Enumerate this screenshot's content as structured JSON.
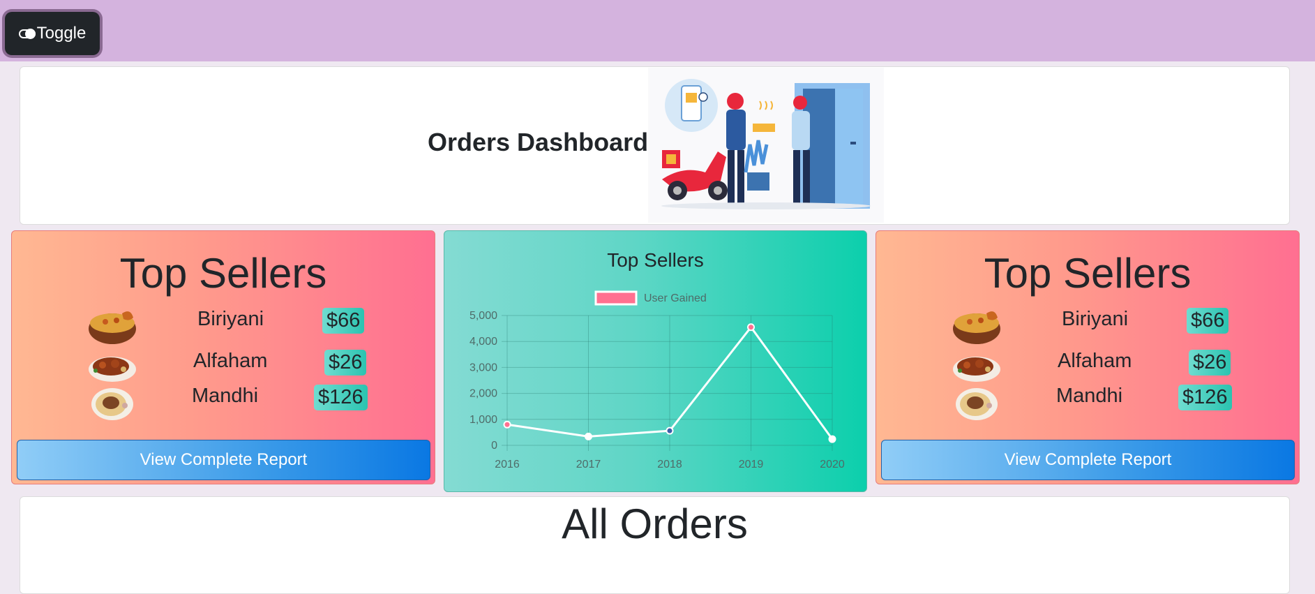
{
  "toolbar": {
    "toggle_label": "Toggle"
  },
  "header": {
    "title": "Orders Dashboard"
  },
  "top_sellers_left": {
    "title": "Top Sellers",
    "items": [
      {
        "name": "Biriyani",
        "price": "$66"
      },
      {
        "name": "Alfaham",
        "price": "$26"
      },
      {
        "name": "Mandhi",
        "price": "$126"
      }
    ],
    "button_label": "View Complete Report"
  },
  "top_sellers_right": {
    "title": "Top Sellers",
    "items": [
      {
        "name": "Biriyani",
        "price": "$66"
      },
      {
        "name": "Alfaham",
        "price": "$26"
      },
      {
        "name": "Mandhi",
        "price": "$126"
      }
    ],
    "button_label": "View Complete Report"
  },
  "chart_data": {
    "type": "line",
    "title": "Top Sellers",
    "x": [
      "2016",
      "2017",
      "2018",
      "2019",
      "2020"
    ],
    "series": [
      {
        "name": "User Gained",
        "values": [
          800,
          340,
          560,
          4550,
          240
        ],
        "color": "#ff7090"
      }
    ],
    "point_colors": [
      "#ff7090",
      "#ffffff",
      "#3b5ea8",
      "#ff7090",
      "#ffffff"
    ],
    "ylim": [
      0,
      5000
    ],
    "yticks": [
      "0",
      "1,000",
      "2,000",
      "3,000",
      "4,000",
      "5,000"
    ],
    "ytick_values": [
      0,
      1000,
      2000,
      3000,
      4000,
      5000
    ],
    "grid": true,
    "legend_position": "top"
  },
  "orders": {
    "title": "All Orders"
  },
  "colors": {
    "topbar": "#d4b3de",
    "seller_gradient_start": "#ffb892",
    "seller_gradient_end": "#ff6f91",
    "chart_gradient_start": "#84dbd3",
    "chart_gradient_end": "#0ccfac",
    "button_blue": "#0a78e3"
  },
  "icons": {
    "toggle": "toggle-switch-icon",
    "foods": [
      "biriyani-pot-icon",
      "alfaham-plate-icon",
      "mandhi-plate-icon"
    ]
  }
}
